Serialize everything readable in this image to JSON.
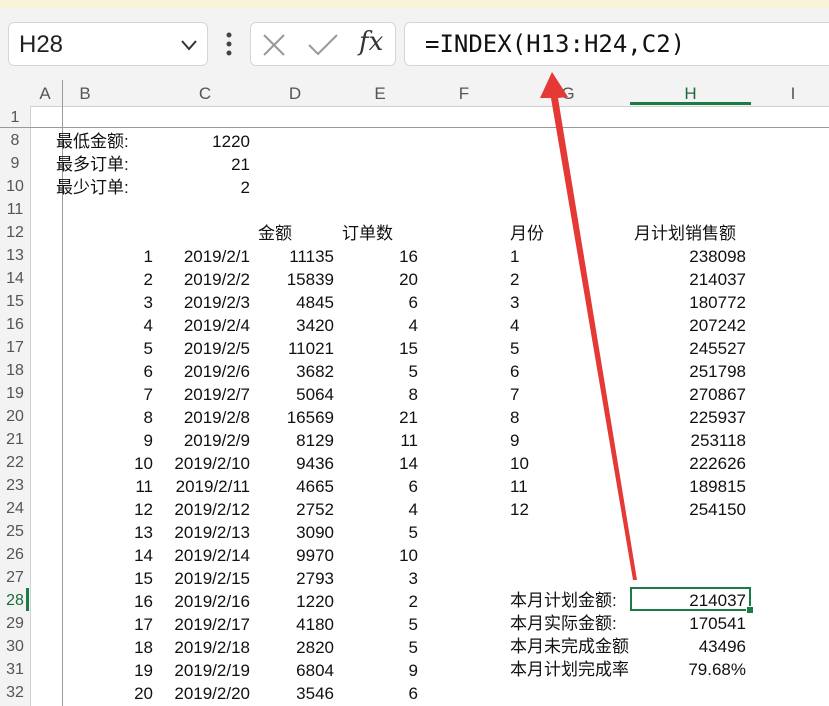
{
  "namebox": {
    "value": "H28"
  },
  "formula_bar": {
    "cancel_icon": "x-icon",
    "enter_icon": "check-icon",
    "fx_label": "fx",
    "formula": "=INDEX(H13:H24,C2)"
  },
  "columns": [
    "A",
    "B",
    "C",
    "D",
    "E",
    "F",
    "G",
    "H",
    "I"
  ],
  "rows": [
    "1",
    "8",
    "9",
    "10",
    "11",
    "12",
    "13",
    "14",
    "15",
    "16",
    "17",
    "18",
    "19",
    "20",
    "21",
    "22",
    "23",
    "24",
    "25",
    "26",
    "27",
    "28",
    "29",
    "30",
    "31",
    "32"
  ],
  "summary": {
    "min_amount_label": "最低金额:",
    "min_amount": "1220",
    "max_orders_label": "最多订单:",
    "max_orders": "21",
    "min_orders_label": "最少订单:",
    "min_orders": "2"
  },
  "table1": {
    "header_amount": "金额",
    "header_orders": "订单数",
    "rows": [
      {
        "no": "1",
        "date": "2019/2/1",
        "amount": "11135",
        "orders": "16"
      },
      {
        "no": "2",
        "date": "2019/2/2",
        "amount": "15839",
        "orders": "20"
      },
      {
        "no": "3",
        "date": "2019/2/3",
        "amount": "4845",
        "orders": "6"
      },
      {
        "no": "4",
        "date": "2019/2/4",
        "amount": "3420",
        "orders": "4"
      },
      {
        "no": "5",
        "date": "2019/2/5",
        "amount": "11021",
        "orders": "15"
      },
      {
        "no": "6",
        "date": "2019/2/6",
        "amount": "3682",
        "orders": "5"
      },
      {
        "no": "7",
        "date": "2019/2/7",
        "amount": "5064",
        "orders": "8"
      },
      {
        "no": "8",
        "date": "2019/2/8",
        "amount": "16569",
        "orders": "21"
      },
      {
        "no": "9",
        "date": "2019/2/9",
        "amount": "8129",
        "orders": "11"
      },
      {
        "no": "10",
        "date": "2019/2/10",
        "amount": "9436",
        "orders": "14"
      },
      {
        "no": "11",
        "date": "2019/2/11",
        "amount": "4665",
        "orders": "6"
      },
      {
        "no": "12",
        "date": "2019/2/12",
        "amount": "2752",
        "orders": "4"
      },
      {
        "no": "13",
        "date": "2019/2/13",
        "amount": "3090",
        "orders": "5"
      },
      {
        "no": "14",
        "date": "2019/2/14",
        "amount": "9970",
        "orders": "10"
      },
      {
        "no": "15",
        "date": "2019/2/15",
        "amount": "2793",
        "orders": "3"
      },
      {
        "no": "16",
        "date": "2019/2/16",
        "amount": "1220",
        "orders": "2"
      },
      {
        "no": "17",
        "date": "2019/2/17",
        "amount": "4180",
        "orders": "5"
      },
      {
        "no": "18",
        "date": "2019/2/18",
        "amount": "2820",
        "orders": "5"
      },
      {
        "no": "19",
        "date": "2019/2/19",
        "amount": "6804",
        "orders": "9"
      },
      {
        "no": "20",
        "date": "2019/2/20",
        "amount": "3546",
        "orders": "6"
      }
    ]
  },
  "table2": {
    "header_month": "月份",
    "header_plan": "月计划销售额",
    "rows": [
      {
        "month": "1",
        "plan": "238098"
      },
      {
        "month": "2",
        "plan": "214037"
      },
      {
        "month": "3",
        "plan": "180772"
      },
      {
        "month": "4",
        "plan": "207242"
      },
      {
        "month": "5",
        "plan": "245527"
      },
      {
        "month": "6",
        "plan": "251798"
      },
      {
        "month": "7",
        "plan": "270867"
      },
      {
        "month": "8",
        "plan": "225937"
      },
      {
        "month": "9",
        "plan": "253118"
      },
      {
        "month": "10",
        "plan": "222626"
      },
      {
        "month": "11",
        "plan": "189815"
      },
      {
        "month": "12",
        "plan": "254150"
      }
    ]
  },
  "results": {
    "plan_label": "本月计划金额:",
    "plan_value": "214037",
    "actual_label": "本月实际金额:",
    "actual_value": "170541",
    "remaining_label": "本月未完成金额",
    "remaining_value": "43496",
    "rate_label": "本月计划完成率",
    "rate_value": "79.68%"
  },
  "colors": {
    "accent_green": "#1a7b45",
    "arrow_red": "#e53935"
  }
}
